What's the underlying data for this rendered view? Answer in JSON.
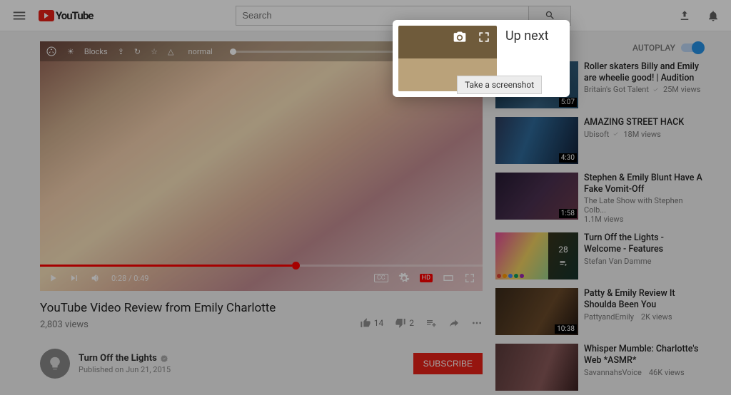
{
  "header": {
    "logo_text": "YouTube",
    "search_placeholder": "Search"
  },
  "player": {
    "top": {
      "blocks": "Blocks",
      "mode": "normal"
    },
    "time_current": "0:28",
    "time_total": "0:49",
    "cc": "CC",
    "hd": "HD"
  },
  "video": {
    "title": "YouTube Video Review from Emily Charlotte",
    "views": "2,803 views",
    "likes": "14",
    "dislikes": "2",
    "channel": "Turn Off the Lights",
    "published": "Published on Jun 21, 2015",
    "subscribe": "SUBSCRIBE"
  },
  "sidebar": {
    "up_next": "Up next",
    "autoplay": "AUTOPLAY",
    "queue_count": "28",
    "items": [
      {
        "title": "Roller skaters Billy and Emily are wheelie good! | Audition",
        "channel": "Britain's Got Talent",
        "views": "25M views",
        "duration": "5:07",
        "verified": true
      },
      {
        "title": "AMAZING STREET HACK",
        "channel": "Ubisoft",
        "views": "18M views",
        "duration": "4:30",
        "verified": true
      },
      {
        "title": "Stephen & Emily Blunt Have A Fake Vomit-Off",
        "channel": "The Late Show with Stephen Colb...",
        "views": "1.1M views",
        "duration": "1:58",
        "verified": false
      },
      {
        "title": "Turn Off the Lights - Welcome - Features",
        "channel": "Stefan Van Damme",
        "views": "",
        "duration": "",
        "verified": false
      },
      {
        "title": "Patty & Emily Review It Shoulda Been You",
        "channel": "PattyandEmily",
        "views": "2K views",
        "duration": "10:38",
        "verified": false
      },
      {
        "title": "Whisper Mumble: Charlotte's Web *ASMR*",
        "channel": "SavannahsVoice",
        "views": "46K views",
        "duration": "",
        "verified": false
      }
    ]
  },
  "popup": {
    "label": "Up next",
    "tooltip": "Take a screenshot"
  }
}
